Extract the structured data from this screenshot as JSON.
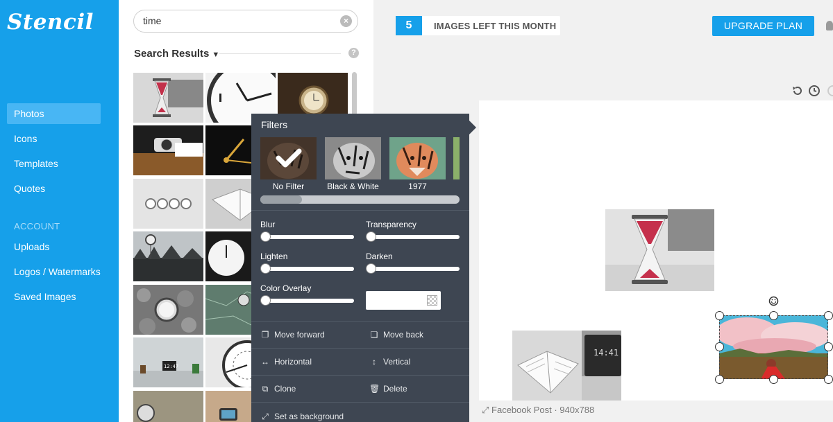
{
  "app": {
    "logo": "Stencil"
  },
  "sidebar": {
    "items": [
      {
        "label": "Photos"
      },
      {
        "label": "Icons"
      },
      {
        "label": "Templates"
      },
      {
        "label": "Quotes"
      }
    ],
    "account_heading": "ACCOUNT",
    "account_items": [
      {
        "label": "Uploads"
      },
      {
        "label": "Logos / Watermarks"
      },
      {
        "label": "Saved Images"
      }
    ]
  },
  "search": {
    "value": "time",
    "clear_icon": "close-circle-icon"
  },
  "results": {
    "title": "Search Results",
    "help_icon": "question-icon"
  },
  "topbar": {
    "images_left": "5",
    "images_left_label": "IMAGES LEFT THIS MONTH",
    "upgrade_label": "UPGRADE PLAN"
  },
  "filters": {
    "title": "Filters",
    "options": [
      {
        "label": "No Filter",
        "selected": true
      },
      {
        "label": "Black & White",
        "selected": false
      },
      {
        "label": "1977",
        "selected": false
      }
    ],
    "adjustments": {
      "blur": "Blur",
      "transparency": "Transparency",
      "lighten": "Lighten",
      "darken": "Darken",
      "color_overlay": "Color Overlay"
    },
    "actions": {
      "move_forward": "Move forward",
      "move_back": "Move back",
      "horizontal": "Horizontal",
      "vertical": "Vertical",
      "clone": "Clone",
      "delete": "Delete",
      "set_background": "Set as background"
    }
  },
  "canvas": {
    "size_label": "Facebook Post · 940x788",
    "laptop_time": "14:41"
  },
  "colors": {
    "accent": "#16a0ea",
    "popup": "#3e4652"
  }
}
